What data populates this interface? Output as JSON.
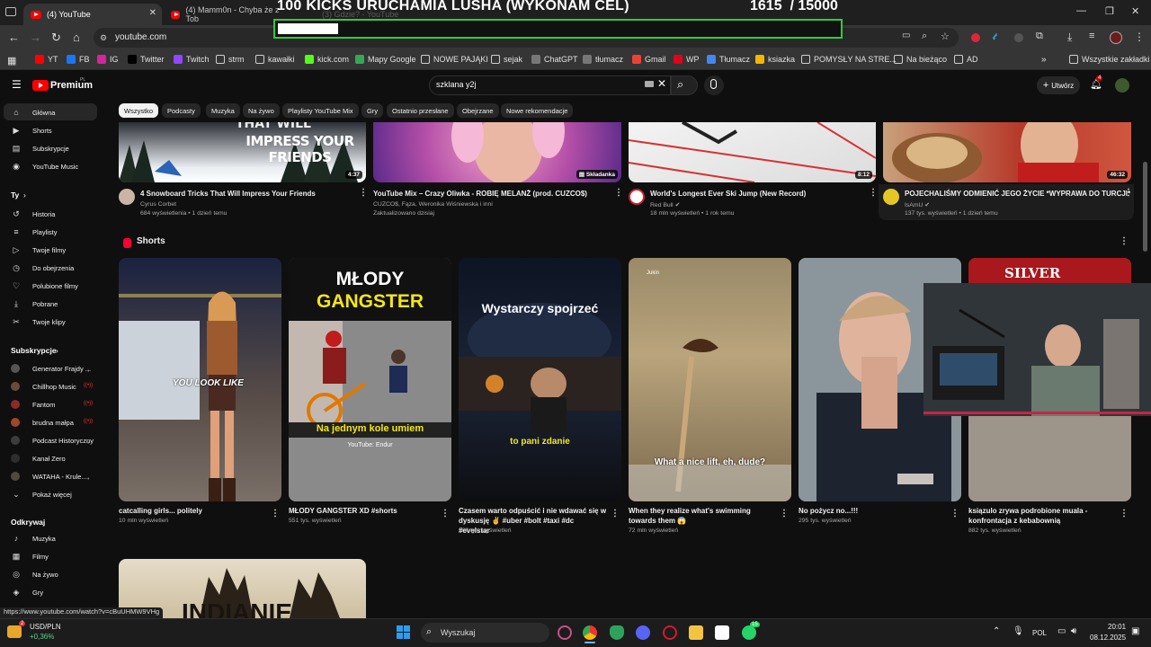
{
  "browser": {
    "tabs": [
      {
        "title": "(4) YouTube",
        "active": true
      },
      {
        "title": "(4) Mamm0n - Chyba że z Tob",
        "active": false
      },
      {
        "title": "(3) Gdzie? - YouTube",
        "active": false
      }
    ],
    "url": "youtube.com",
    "bookmarks": [
      "YT",
      "FB",
      "IG",
      "Twitter",
      "Twitch",
      "strm",
      "kawałki",
      "kick.com",
      "Mapy Google",
      "NOWE PAJĄKI",
      "sejak",
      "ChatGPT",
      "tłumacz",
      "Gmail",
      "WP",
      "Tłumacz",
      "ksiazka",
      "POMYSŁY NA STRE...",
      "Na bieżąco",
      "AD"
    ],
    "all_bookmarks": "Wszystkie zakładki",
    "status_url": "https://www.youtube.com/watch?v=cBuUHMW9VHg"
  },
  "overlay": {
    "title": "100 KICKS URUCHAMIA LUSHA (WYKONAM CEL)",
    "current": "1615",
    "goal": "/ 15000",
    "progress": 0.108
  },
  "youtube": {
    "brand": "Premium",
    "brand_region": "PL",
    "search_query": "szklana y2j",
    "create_label": "Utwórz",
    "notifications": "4",
    "chips": [
      "Wszystko",
      "Podcasty",
      "Muzyka",
      "Na żywo",
      "Playlisty YouTube Mix",
      "Gry",
      "Ostatnio przesłane",
      "Obejrzane",
      "Nowe rekomendacje"
    ],
    "sidebar": {
      "main": [
        "Główna",
        "Shorts",
        "Subskrypcje",
        "YouTube Music"
      ],
      "you_header": "Ty",
      "you": [
        "Historia",
        "Playlisty",
        "Twoje filmy",
        "Do obejrzenia",
        "Polubione filmy",
        "Pobrane",
        "Twoje klipy"
      ],
      "subs_header": "Subskrypcje",
      "subs": [
        "Generator Frajdy ...",
        "Chillhop Music",
        "Fantom",
        "brudna małpa",
        "Podcast Historyczny",
        "Kanał Zero",
        "WATAHA - Krule...",
        "Pokaż więcej"
      ],
      "explore_header": "Odkrywaj",
      "explore": [
        "Muzyka",
        "Filmy",
        "Na żywo",
        "Gry"
      ]
    },
    "videos": [
      {
        "title": "4 Snowboard Tricks That Will  Impress Your Friends",
        "channel": "Cyrus Corbet",
        "meta": "684 wyświetlenia • 1 dzień temu",
        "duration": "4:37",
        "thumb_text": "IMPRESS YOUR FRIENDS",
        "thumb_top": "THAT WILL"
      },
      {
        "title": "YouTube Mix – Crazy Oliwka - ROBIĘ MELANŻ (prod. CUZCO$)",
        "channel": "CUZCO$, Fąza, Weronika Wiśniewska i inni",
        "meta": "Zaktualizowano dzisiaj",
        "duration": "Składanka"
      },
      {
        "title": "World's Longest Ever Ski Jump (New Record)",
        "channel": "Red Bull",
        "meta": "18 mln wyświetleń • 1 rok temu",
        "duration": "8:12"
      },
      {
        "title": "POJECHALIŚMY ODMIENIĆ JEGO ŻYCIE *WYPRAWA DO TURCJI*",
        "channel": "IsAmU",
        "meta": "137 tys. wyświetleń • 1 dzień temu",
        "duration": "46:32"
      }
    ],
    "shorts_header": "Shorts",
    "shorts": [
      {
        "title": "catcalling girls... politely",
        "meta": "10 mln wyświetleń",
        "caption": "YOU LOOK LIKE"
      },
      {
        "title": "MŁODY GANGSTER XD #shorts",
        "meta": "551 tys. wyświetleń",
        "caption_top": "MŁODY",
        "caption_mid": "GANGSTER",
        "caption": "Na jednym kole umiem",
        "credit": "YouTube: Endur"
      },
      {
        "title": "Czasem warto odpuścić i nie wdawać się w dyskusję ✌️ #uber #bolt #taxi #dc #evelstar",
        "meta": "208 tys. wyświetleń",
        "caption_top": "Wystarczy spojrzeć",
        "caption": "to pani  zdanie"
      },
      {
        "title": "When they realize what's swimming towards them 😱",
        "meta": "72 mln wyświetleń",
        "caption": "What a nice lift, eh, dude?",
        "credit": "Jukin"
      },
      {
        "title": "No pożycz no...!!!",
        "meta": "295 tys. wyświetleń"
      },
      {
        "title": "ksiązulo zrywa podrobione muala - konfrontacja z kebabownią",
        "meta": "882 tys. wyświetleń",
        "caption_top": "SILVER"
      }
    ],
    "bottom_thumb_text": "INDIANIE"
  },
  "taskbar": {
    "search_placeholder": "Wyszukaj",
    "stock_name": "USD/PLN",
    "stock_change": "+0,36%",
    "stock_badge": "2",
    "whatsapp_badge": "15",
    "lang": "POL",
    "time": "20:01",
    "date": "08.12.2025"
  }
}
